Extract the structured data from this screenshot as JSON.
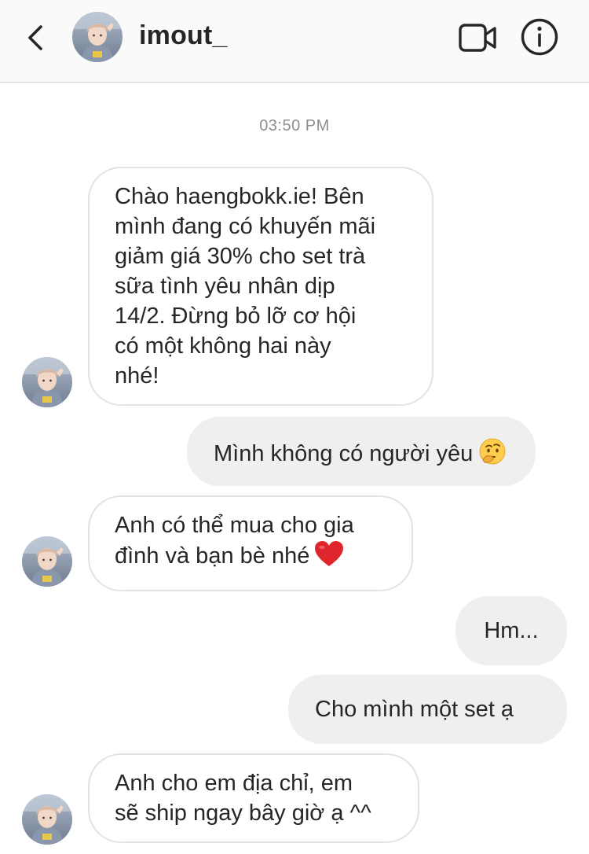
{
  "header": {
    "username": "imout_",
    "icons": {
      "back": "chevron-left-icon",
      "video": "video-camera-icon",
      "info": "info-icon"
    }
  },
  "conversation": {
    "timestamp": "03:50 PM",
    "messages": [
      {
        "sender": "them",
        "lines": [
          "Chào haengbokk.ie! Bên",
          "mình đang có khuyến mãi",
          "giảm giá 30% cho set trà",
          "sữa tình yêu nhân dịp",
          "14/2. Đừng bỏ lỡ cơ hội",
          "có một không hai này",
          "nhé!"
        ]
      },
      {
        "sender": "me",
        "text": "Mình không có người yêu",
        "emoji": "thinking-face-emoji"
      },
      {
        "sender": "them",
        "lines": [
          "Anh có thể mua cho gia",
          "đình và bạn bè nhé"
        ],
        "emoji": "red-heart-emoji"
      },
      {
        "sender": "me",
        "text": "Hm..."
      },
      {
        "sender": "me",
        "text": "Cho mình một set ạ"
      },
      {
        "sender": "them",
        "lines": [
          "Anh cho em địa chỉ, em",
          "sẽ ship ngay bây giờ ạ ^^"
        ]
      }
    ]
  },
  "colors": {
    "header_bg": "#fafafa",
    "incoming_border": "#e3e3e3",
    "outgoing_bg": "#efefef",
    "text": "#262626",
    "timestamp": "#8e8e8e"
  }
}
